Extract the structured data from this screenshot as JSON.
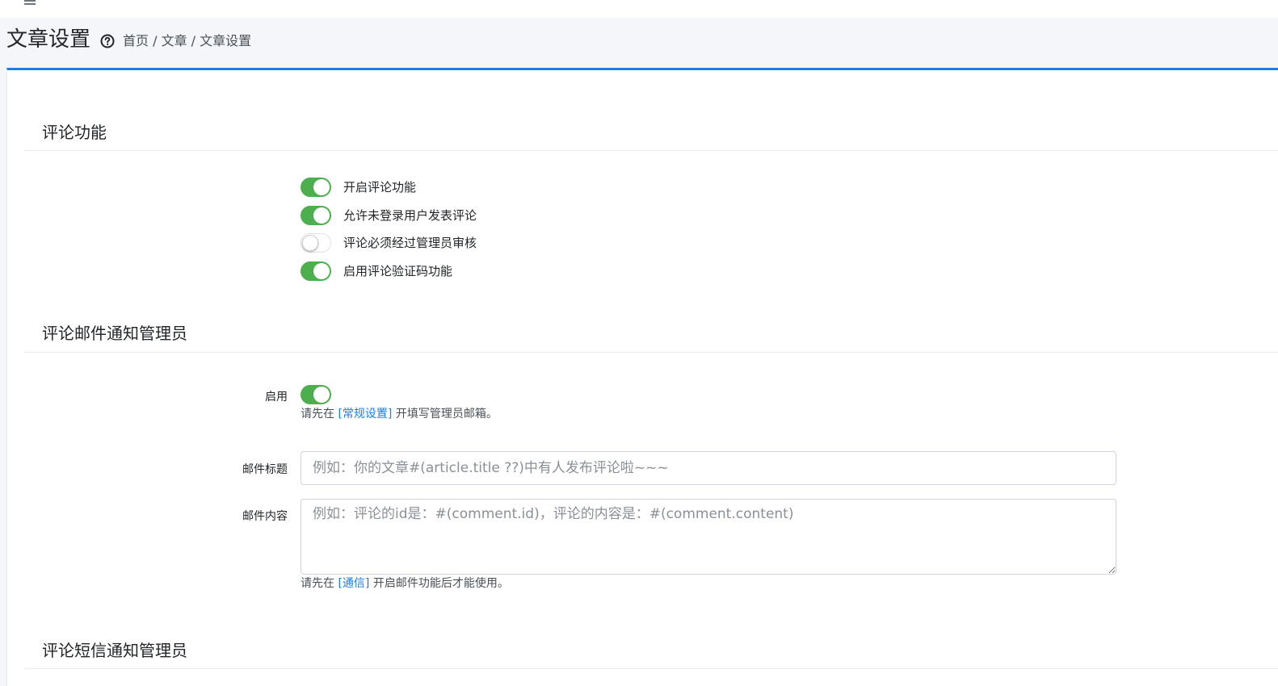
{
  "header": {
    "title": "文章设置",
    "breadcrumb": "首页 / 文章 / 文章设置"
  },
  "colors": {
    "accent": "#1a7ee8",
    "toggle_on": "#4cae4c"
  },
  "sections": {
    "comment": {
      "title": "评论功能",
      "toggles": [
        {
          "label": "开启评论功能",
          "on": true
        },
        {
          "label": "允许未登录用户发表评论",
          "on": true
        },
        {
          "label": "评论必须经过管理员审核",
          "on": false
        },
        {
          "label": "启用评论验证码功能",
          "on": true
        }
      ]
    },
    "email": {
      "title": "评论邮件通知管理员",
      "enable_label": "启用",
      "enable_on": true,
      "enable_help_prefix": "请先在 ",
      "enable_help_link": "[常规设置]",
      "enable_help_suffix": " 开填写管理员邮箱。",
      "subject_label": "邮件标题",
      "subject_placeholder": "例如：你的文章#(article.title ??)中有人发布评论啦~~~",
      "content_label": "邮件内容",
      "content_placeholder": "例如：评论的id是：#(comment.id)，评论的内容是：#(comment.content)",
      "content_help_prefix": "请先在 ",
      "content_help_link": "[通信]",
      "content_help_suffix": " 开启邮件功能后才能使用。"
    },
    "sms": {
      "title": "评论短信通知管理员"
    }
  }
}
